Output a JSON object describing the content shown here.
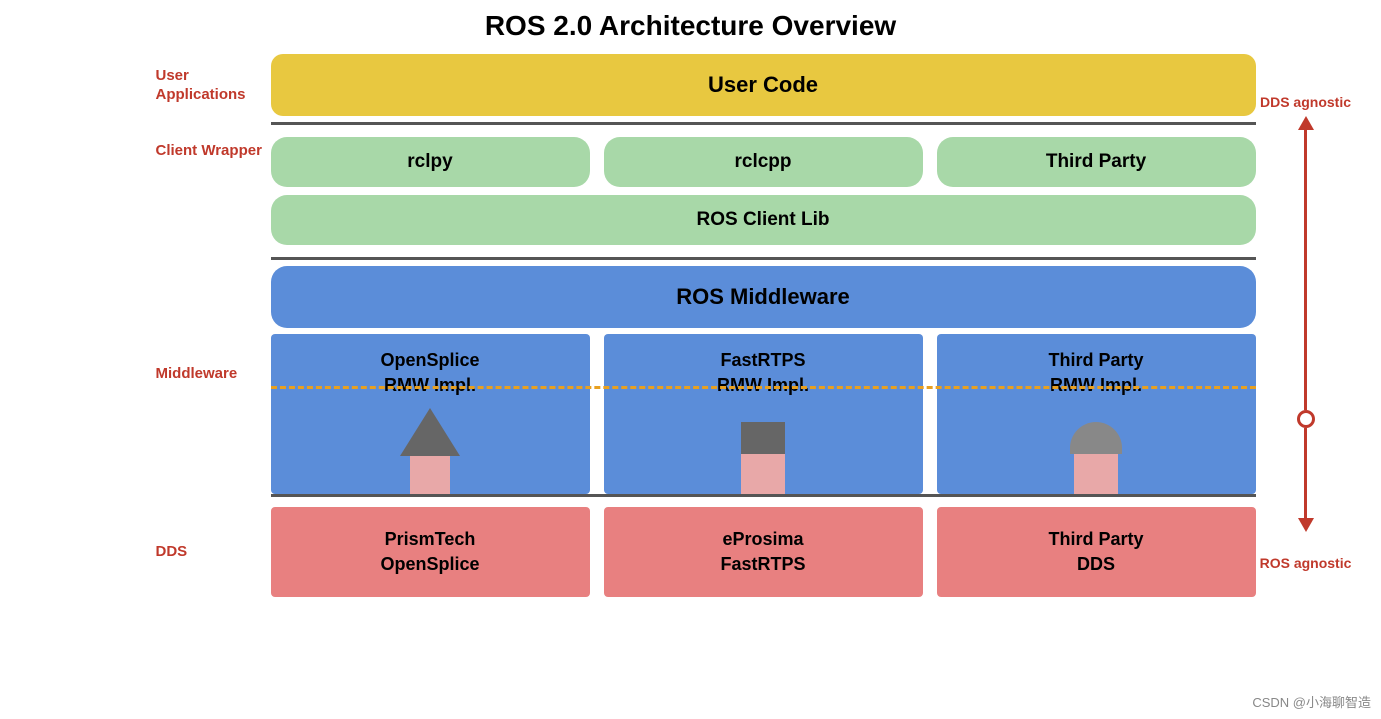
{
  "title": "ROS 2.0 Architecture Overview",
  "layers": {
    "userApplications": {
      "label": "User\nApplications",
      "userCode": "User Code"
    },
    "clientWrapper": {
      "label": "Client\nWrapper",
      "rclpy": "rclpy",
      "rclcpp": "rclcpp",
      "thirdParty": "Third Party",
      "rosClientLib": "ROS Client Lib"
    },
    "middleware": {
      "rosMiddleware": "ROS Middleware",
      "label": "Middleware",
      "openSplice": "OpenSplice\nRMW Impl.",
      "fastRTPS": "FastRTPS\nRMW Impl.",
      "thirdPartyRMW": "Third Party\nRMW Impl."
    },
    "dds": {
      "label": "DDS",
      "prismTech": "PrismTech\nOpenSplice",
      "eProsima": "eProsima\nFastRTPS",
      "thirdPartyDDS": "Third Party\nDDS"
    }
  },
  "rightLabels": {
    "ddsAgnostic": "DDS\nagnostic",
    "rosAgnostic": "ROS\nagnostic"
  },
  "watermark": "CSDN @小海聊智造",
  "colors": {
    "userCode": "#e8c840",
    "green": "#a8d8a8",
    "blue": "#5b8dd9",
    "pink": "#e88080",
    "red": "#c0392b",
    "orange": "#e8a020",
    "dark": "#555555"
  }
}
